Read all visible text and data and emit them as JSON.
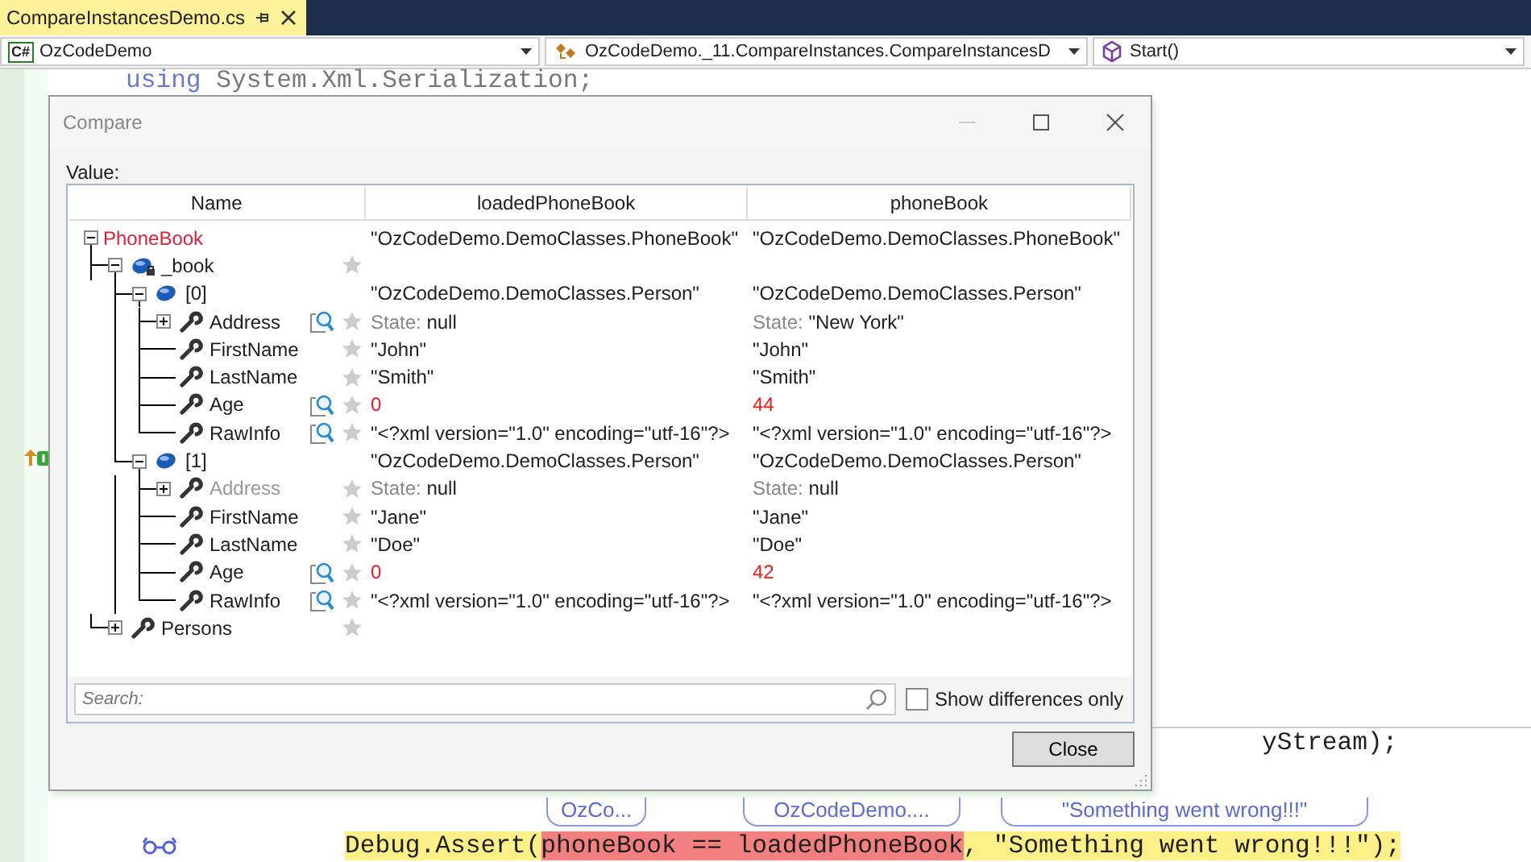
{
  "editor": {
    "tab": {
      "title": "CompareInstancesDemo.cs",
      "selected": true
    },
    "nav": [
      {
        "kind": "csharp",
        "badge": "C#",
        "text": "OzCodeDemo"
      },
      {
        "kind": "class",
        "text": "OzCodeDemo._11.CompareInstances.CompareInstancesD"
      },
      {
        "kind": "method",
        "text": "Start()"
      }
    ],
    "lines": [
      {
        "kind": "top",
        "segments": [
          {
            "kind": "keyword",
            "text": "using"
          },
          {
            "kind": "plain",
            "text": " System.Xml.Serialization;"
          }
        ]
      },
      {
        "kind": "partial",
        "segments": [
          {
            "kind": "plain",
            "text": "yStream);"
          }
        ]
      },
      {
        "kind": "current",
        "segments": [
          {
            "kind": "plain",
            "text": "Debug.Assert("
          },
          {
            "kind": "highlight",
            "text": "phoneBook == loadedPhoneBook"
          },
          {
            "kind": "plain",
            "text": ", \"Something went wrong!!!\");"
          }
        ]
      }
    ],
    "datatips": [
      "OzCo...",
      "OzCodeDemo....",
      "\"Something went wrong!!!\""
    ]
  },
  "compare_dialog": {
    "title": "Compare",
    "value_label": "Value:",
    "columns": [
      "Name",
      "loadedPhoneBook",
      "phoneBook"
    ],
    "rows": [
      {
        "name": "PhoneBook",
        "highlight": true,
        "expanded": true,
        "loaded": {
          "text": "\"OzCodeDemo.DemoClasses.PhoneBook\""
        },
        "phone": {
          "text": "\"OzCodeDemo.DemoClasses.PhoneBook\""
        },
        "children": [
          {
            "name": "_book",
            "kind": "object",
            "private": true,
            "expanded": true,
            "star": true,
            "children": [
              {
                "name": "[0]",
                "kind": "object",
                "expanded": true,
                "loaded": {
                  "text": "\"OzCodeDemo.DemoClasses.Person\""
                },
                "phone": {
                  "text": "\"OzCodeDemo.DemoClasses.Person\""
                },
                "children": [
                  {
                    "name": "Address",
                    "kind": "property",
                    "expanded": false,
                    "inspect": true,
                    "star": true,
                    "loaded": {
                      "label": "State:",
                      "text": "null"
                    },
                    "phone": {
                      "label": "State:",
                      "text": "\"New York\""
                    }
                  },
                  {
                    "name": "FirstName",
                    "kind": "property",
                    "star": true,
                    "loaded": {
                      "text": "\"John\""
                    },
                    "phone": {
                      "text": "\"John\""
                    }
                  },
                  {
                    "name": "LastName",
                    "kind": "property",
                    "star": true,
                    "loaded": {
                      "text": "\"Smith\""
                    },
                    "phone": {
                      "text": "\"Smith\""
                    }
                  },
                  {
                    "name": "Age",
                    "kind": "property",
                    "inspect": true,
                    "star": true,
                    "differs": true,
                    "loaded": {
                      "text": "0"
                    },
                    "phone": {
                      "text": "44"
                    }
                  },
                  {
                    "name": "RawInfo",
                    "kind": "property",
                    "inspect": true,
                    "star": true,
                    "loaded": {
                      "text": "\"<?xml version=\"1.0\" encoding=\"utf-16\"?>"
                    },
                    "phone": {
                      "text": "\"<?xml version=\"1.0\" encoding=\"utf-16\"?>"
                    }
                  }
                ]
              },
              {
                "name": "[1]",
                "kind": "object",
                "expanded": true,
                "loaded": {
                  "text": "\"OzCodeDemo.DemoClasses.Person\""
                },
                "phone": {
                  "text": "\"OzCodeDemo.DemoClasses.Person\""
                },
                "children": [
                  {
                    "name": "Address",
                    "kind": "property",
                    "expanded": false,
                    "dimmed": true,
                    "star": true,
                    "loaded": {
                      "label": "State:",
                      "text": "null"
                    },
                    "phone": {
                      "label": "State:",
                      "text": "null"
                    }
                  },
                  {
                    "name": "FirstName",
                    "kind": "property",
                    "star": true,
                    "loaded": {
                      "text": "\"Jane\""
                    },
                    "phone": {
                      "text": "\"Jane\""
                    }
                  },
                  {
                    "name": "LastName",
                    "kind": "property",
                    "star": true,
                    "loaded": {
                      "text": "\"Doe\""
                    },
                    "phone": {
                      "text": "\"Doe\""
                    }
                  },
                  {
                    "name": "Age",
                    "kind": "property",
                    "inspect": true,
                    "star": true,
                    "differs": true,
                    "loaded": {
                      "text": "0"
                    },
                    "phone": {
                      "text": "42"
                    }
                  },
                  {
                    "name": "RawInfo",
                    "kind": "property",
                    "inspect": true,
                    "star": true,
                    "loaded": {
                      "text": "\"<?xml version=\"1.0\" encoding=\"utf-16\"?>"
                    },
                    "phone": {
                      "text": "\"<?xml version=\"1.0\" encoding=\"utf-16\"?>"
                    }
                  }
                ]
              }
            ]
          },
          {
            "name": "Persons",
            "kind": "property",
            "expanded": false,
            "star": true
          }
        ]
      }
    ],
    "search": {
      "placeholder": "Search:"
    },
    "show_differences": {
      "label": "Show differences only",
      "checked": false
    },
    "close_button": "Close"
  }
}
